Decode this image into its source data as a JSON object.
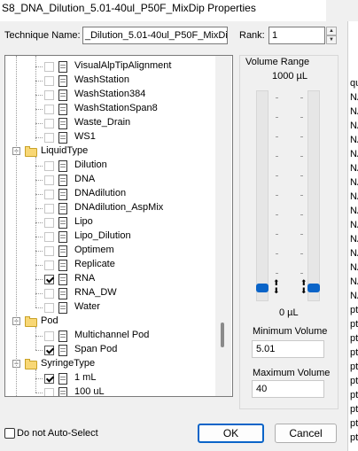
{
  "window": {
    "title": "S8_DNA_Dilution_5.01-40ul_P50F_MixDip Properties"
  },
  "technique": {
    "label": "Technique Name:",
    "value": "_Dilution_5.01-40ul_P50F_MixDip"
  },
  "rank": {
    "label": "Rank:",
    "value": "1"
  },
  "tree": {
    "items": [
      {
        "label": "VisualAlpTipAlignment",
        "checked": false
      },
      {
        "label": "WashStation",
        "checked": false
      },
      {
        "label": "WashStation384",
        "checked": false
      },
      {
        "label": "WashStationSpan8",
        "checked": false
      },
      {
        "label": "Waste_Drain",
        "checked": false
      },
      {
        "label": "WS1",
        "checked": false
      },
      {
        "label": "LiquidType",
        "folder": true
      },
      {
        "label": "Dilution",
        "checked": false
      },
      {
        "label": "DNA",
        "checked": false
      },
      {
        "label": "DNAdilution",
        "checked": false
      },
      {
        "label": "DNAdilution_AspMix",
        "checked": false
      },
      {
        "label": "Lipo",
        "checked": false
      },
      {
        "label": "Lipo_Dilution",
        "checked": false
      },
      {
        "label": "Optimem",
        "checked": false
      },
      {
        "label": "Replicate",
        "checked": false
      },
      {
        "label": "RNA",
        "checked": true
      },
      {
        "label": "RNA_DW",
        "checked": false
      },
      {
        "label": "Water",
        "checked": false
      },
      {
        "label": "Pod",
        "folder": true
      },
      {
        "label": "Multichannel Pod",
        "checked": false
      },
      {
        "label": "Span Pod",
        "checked": true
      },
      {
        "label": "SyringeType",
        "folder": true
      },
      {
        "label": "1 mL",
        "checked": true
      },
      {
        "label": "100 uL",
        "checked": false
      }
    ]
  },
  "volume_range": {
    "title": "Volume Range",
    "max_label": "1000 µL",
    "min_label": "0 µL",
    "min_level": 0.0,
    "max_level": 0.0
  },
  "minimum_volume": {
    "label": "Minimum Volume",
    "value": "5.01"
  },
  "maximum_volume": {
    "label": "Maximum Volume",
    "value": "40"
  },
  "no_auto_select": {
    "label": "Do not Auto-Select",
    "checked": false
  },
  "buttons": {
    "ok": "OK",
    "cancel": "Cancel"
  },
  "background_window": {
    "lines": [
      "qui.",
      "NA",
      "NA",
      "NA",
      "NA",
      "NA",
      "NA",
      "NA",
      "NA",
      "NA",
      "NA",
      "NA",
      "NA",
      "NA",
      "NA",
      "NA",
      "pt.",
      "pt.",
      "pt.",
      "pt.",
      "pt.",
      "pt.",
      "pt.",
      "pt.",
      "pt.",
      "pt."
    ]
  }
}
